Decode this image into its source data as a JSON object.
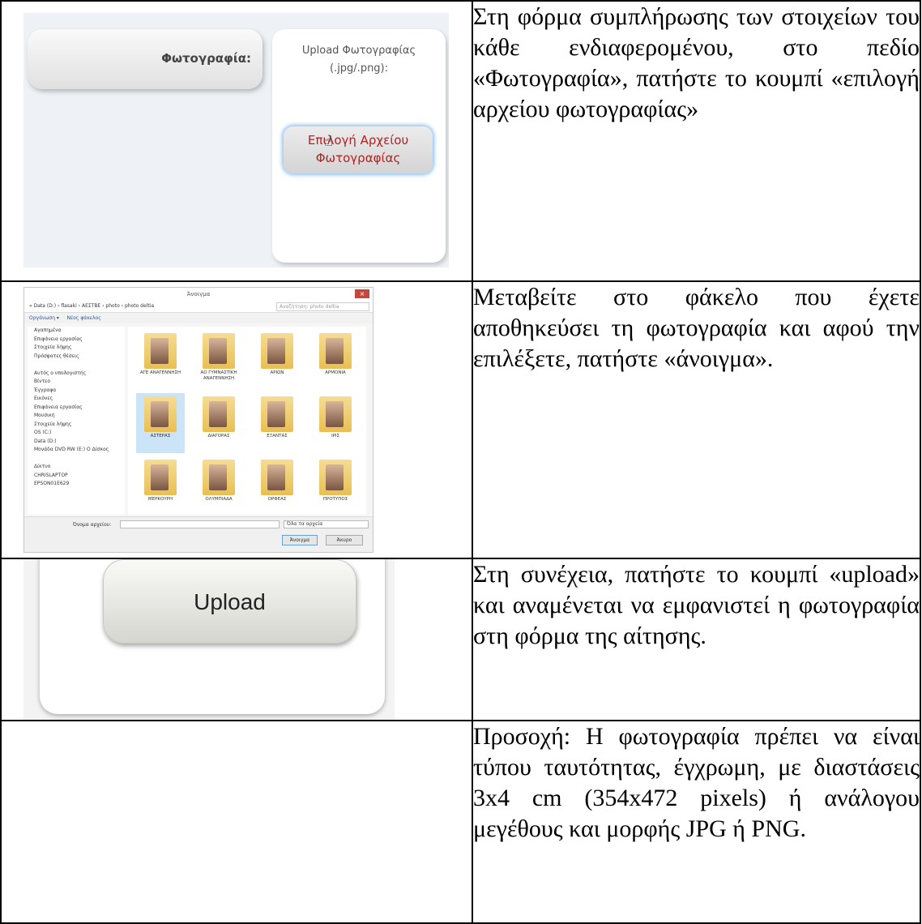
{
  "rows": [
    {
      "text": "Στη φόρμα συμπλήρωσης των στοιχείων του κάθε ενδιαφερομένου, στο πεδίο «Φωτογραφία», πατήστε το κουμπί «επιλογή αρχείου φωτογραφίας»",
      "form": {
        "photo_label": "Φωτογραφία:",
        "upload_title": "Upload Φωτογραφίας",
        "upload_formats": "(.jpg/.png):",
        "choose_line1": "Επιλογή Αρχείου",
        "choose_line2": "Φωτογραφίας"
      }
    },
    {
      "text": "Μεταβείτε στο φάκελο που έχετε αποθηκεύσει τη φωτογραφία και αφού την επιλέξετε, πατήστε «άνοιγμα».",
      "dialog": {
        "title": "Άνοιγμα",
        "close": "×",
        "path": "« Data (D:) › flasaki › ΑΕΣΤΒΕ › photo › photo deltia",
        "search_placeholder": "Αναζήτηση: photo deltia",
        "organize": "Οργάνωση ▾",
        "new_folder": "Νέος φάκελος",
        "nav_items": [
          "Αγαπημένα",
          "Επιφάνεια εργασίας",
          "Στοιχεία λήψης",
          "Πρόσφατες θέσεις",
          "",
          "Αυτός ο υπολογιστής",
          "Βίντεο",
          "Έγγραφα",
          "Εικόνες",
          "Επιφάνεια εργασίας",
          "Μουσική",
          "Στοιχεία λήψης",
          "OS (C:)",
          "Data (D:)",
          "Μονάδα DVD RW (E:) O Δίσκος",
          "",
          "Δίκτυο",
          "CHRISLAPTOP",
          "EPSON01E629"
        ],
        "folders": [
          "ΑΓΕ ΑΝΑΓΕΝΝΗΣΗ",
          "ΑΟ ΓΥΜΝΑΣΤΙΚΗ ΑΝΑΓΕΝΝΗΣΗ",
          "ΑΡΙΩΝ",
          "ΑΡΜΟΝΙΑ",
          "ΑΣΤΕΡΑΣ",
          "ΔΙΑΓΟΡΑΣ",
          "ΕΞΑΝΤΑΣ",
          "ΙΡΙΣ",
          "ΜΕΡΚΟΥΡΗ",
          "ΟΛΥΜΠΙΑΔΑ",
          "ΟΡΦΕΑΣ",
          "ΠΡΟΤΥΠΟΣ"
        ],
        "filename_label": "Όνομα αρχείου:",
        "filetype": "Όλα τα αρχεία",
        "open": "Άνοιγμα",
        "cancel": "Άκυρο"
      }
    },
    {
      "text": "Στη συνέχεια, πατήστε το κουμπί «upload» και αναμένεται να εμφανιστεί η φωτογραφία στη φόρμα της αίτησης.",
      "upload_label": "Upload"
    },
    {
      "text": "Προσοχή: Η φωτογραφία πρέπει να είναι τύπου ταυτότητας, έγχρωμη, με διαστάσεις 3x4 cm (354x472 pixels) ή ανάλογου μεγέθους και μορφής JPG ή PNG."
    }
  ]
}
